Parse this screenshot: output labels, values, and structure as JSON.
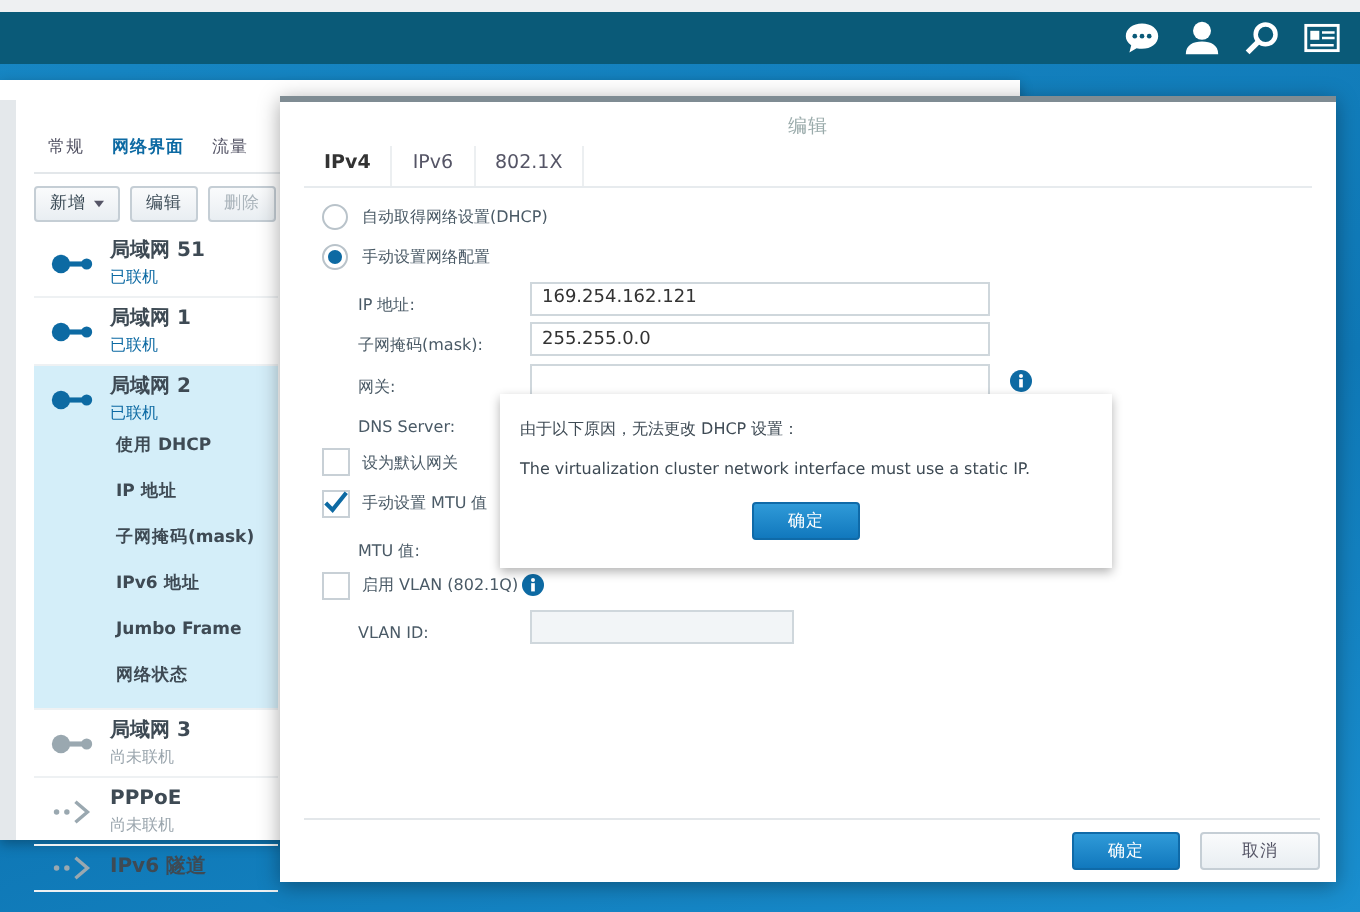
{
  "network_window": {
    "tabs": [
      {
        "label": "常规",
        "selected": false
      },
      {
        "label": "网络界面",
        "selected": true
      },
      {
        "label": "流量",
        "selected": false
      }
    ],
    "buttons": [
      {
        "label": "新增",
        "dropdown": true,
        "disabled": false
      },
      {
        "label": "编辑",
        "dropdown": false,
        "disabled": false
      },
      {
        "label": "删除",
        "dropdown": false,
        "disabled": true
      }
    ],
    "interfaces": [
      {
        "name": "局域网 51",
        "status": "已联机",
        "kind": "lan",
        "connected": true,
        "selected": false
      },
      {
        "name": "局域网 1",
        "status": "已联机",
        "kind": "lan",
        "connected": true,
        "selected": false
      },
      {
        "name": "局域网 2",
        "status": "已联机",
        "kind": "lan",
        "connected": true,
        "selected": true,
        "details": [
          "使用 DHCP",
          "IP 地址",
          "子网掩码(mask)",
          "IPv6 地址",
          "Jumbo Frame",
          "网络状态"
        ]
      },
      {
        "name": "局域网 3",
        "status": "尚未联机",
        "kind": "lan",
        "connected": false,
        "selected": false
      },
      {
        "name": "PPPoE",
        "status": "尚未联机",
        "kind": "tunnel",
        "connected": false,
        "selected": false
      },
      {
        "name": "IPv6 隧道",
        "kind": "tunnel",
        "connected": false,
        "selected": false
      }
    ]
  },
  "edit_dialog": {
    "title": "编辑",
    "tabs": [
      {
        "label": "IPv4",
        "selected": true
      },
      {
        "label": "IPv6",
        "selected": false
      },
      {
        "label": "802.1X",
        "selected": false
      }
    ],
    "rows": [
      {
        "kind": "radio",
        "label": "自动取得网络设置(DHCP)",
        "selected": false
      },
      {
        "kind": "radio",
        "label": "手动设置网络配置",
        "selected": true
      },
      {
        "kind": "field",
        "label": "IP 地址:",
        "value": "169.254.162.121",
        "disabled": false
      },
      {
        "kind": "field",
        "label": "子网掩码(mask):",
        "value": "255.255.0.0",
        "disabled": false
      },
      {
        "kind": "field",
        "label": "网关:",
        "value": "",
        "disabled": false,
        "info": true
      },
      {
        "kind": "label",
        "label": "DNS Server:"
      },
      {
        "kind": "checkbox",
        "label": "设为默认网关",
        "checked": false
      },
      {
        "kind": "checkbox",
        "label": "手动设置 MTU 值",
        "checked": true
      },
      {
        "kind": "label",
        "label": "MTU 值:"
      },
      {
        "kind": "checkbox",
        "label": "启用 VLAN (802.1Q)",
        "checked": false,
        "info": true
      },
      {
        "kind": "field",
        "label": "VLAN ID:",
        "value": "",
        "disabled": true
      }
    ],
    "buttons": [
      {
        "label": "确定",
        "primary": true
      },
      {
        "label": "取消",
        "primary": false
      }
    ]
  },
  "alert": {
    "message": "由于以下原因，无法更改 DHCP 设置：",
    "detail": "The virtualization cluster network interface must use a static IP.",
    "button": "确定"
  }
}
